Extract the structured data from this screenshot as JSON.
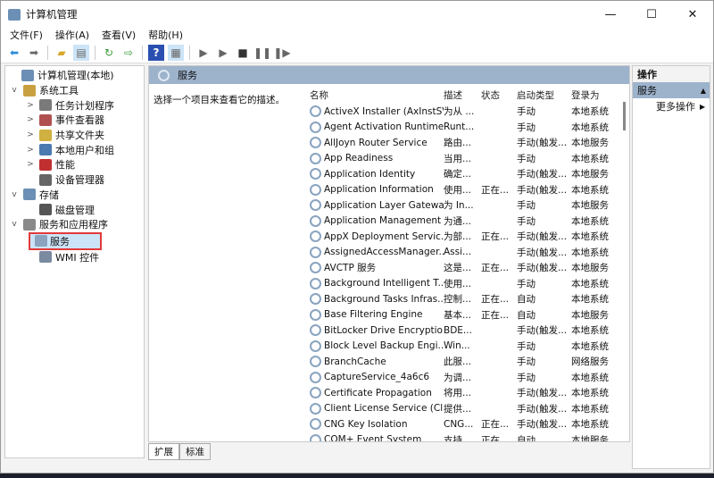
{
  "window": {
    "title": "计算机管理",
    "controls": [
      "—",
      "☐",
      "✕"
    ]
  },
  "menu": [
    "文件(F)",
    "操作(A)",
    "查看(V)",
    "帮助(H)"
  ],
  "toolbar": {
    "icons": [
      "back-icon",
      "forward-icon",
      "up-folder-icon",
      "show-hide-tree-icon",
      "refresh-icon",
      "export-icon",
      "help-icon",
      "properties-icon",
      "start-icon",
      "start-alt-icon",
      "stop-icon",
      "pause-icon",
      "resume-icon"
    ]
  },
  "tree": [
    {
      "label": "计算机管理(本地)",
      "level": 0,
      "expander": ""
    },
    {
      "label": "系统工具",
      "level": 1,
      "expander": "v"
    },
    {
      "label": "任务计划程序",
      "level": 2,
      "expander": ">"
    },
    {
      "label": "事件查看器",
      "level": 2,
      "expander": ">"
    },
    {
      "label": "共享文件夹",
      "level": 2,
      "expander": ">"
    },
    {
      "label": "本地用户和组",
      "level": 2,
      "expander": ">"
    },
    {
      "label": "性能",
      "level": 2,
      "expander": ">"
    },
    {
      "label": "设备管理器",
      "level": 2,
      "expander": ""
    },
    {
      "label": "存储",
      "level": 1,
      "expander": "v"
    },
    {
      "label": "磁盘管理",
      "level": 2,
      "expander": ""
    },
    {
      "label": "服务和应用程序",
      "level": 1,
      "expander": "v"
    },
    {
      "label": "服务",
      "level": 2,
      "expander": "",
      "selected": true
    },
    {
      "label": "WMI 控件",
      "level": 2,
      "expander": ""
    }
  ],
  "main": {
    "header": "服务",
    "description": "选择一个项目来查看它的描述。",
    "columns": [
      "名称",
      "描述",
      "状态",
      "启动类型",
      "登录为"
    ],
    "rows": [
      [
        "ActiveX Installer (AxInstSV)",
        "为从 ...",
        "",
        "手动",
        "本地系统"
      ],
      [
        "Agent Activation Runtime...",
        "Runt...",
        "",
        "手动",
        "本地系统"
      ],
      [
        "AllJoyn Router Service",
        "路由...",
        "",
        "手动(触发...",
        "本地服务"
      ],
      [
        "App Readiness",
        "当用...",
        "",
        "手动",
        "本地系统"
      ],
      [
        "Application Identity",
        "确定...",
        "",
        "手动(触发...",
        "本地服务"
      ],
      [
        "Application Information",
        "使用...",
        "正在...",
        "手动(触发...",
        "本地系统"
      ],
      [
        "Application Layer Gatewa...",
        "为 In...",
        "",
        "手动",
        "本地服务"
      ],
      [
        "Application Management",
        "为通...",
        "",
        "手动",
        "本地系统"
      ],
      [
        "AppX Deployment Servic...",
        "为部...",
        "正在...",
        "手动(触发...",
        "本地系统"
      ],
      [
        "AssignedAccessManager...",
        "Assi...",
        "",
        "手动(触发...",
        "本地系统"
      ],
      [
        "AVCTP 服务",
        "这是...",
        "正在...",
        "手动(触发...",
        "本地服务"
      ],
      [
        "Background Intelligent T...",
        "使用...",
        "",
        "手动",
        "本地系统"
      ],
      [
        "Background Tasks Infras...",
        "控制...",
        "正在...",
        "自动",
        "本地系统"
      ],
      [
        "Base Filtering Engine",
        "基本...",
        "正在...",
        "自动",
        "本地服务"
      ],
      [
        "BitLocker Drive Encryptio...",
        "BDE...",
        "",
        "手动(触发...",
        "本地系统"
      ],
      [
        "Block Level Backup Engi...",
        "Win...",
        "",
        "手动",
        "本地系统"
      ],
      [
        "BranchCache",
        "此服...",
        "",
        "手动",
        "网络服务"
      ],
      [
        "CaptureService_4a6c6",
        "为调...",
        "",
        "手动",
        "本地系统"
      ],
      [
        "Certificate Propagation",
        "将用...",
        "",
        "手动(触发...",
        "本地系统"
      ],
      [
        "Client License Service (Cli...",
        "提供...",
        "",
        "手动(触发...",
        "本地系统"
      ],
      [
        "CNG Key Isolation",
        "CNG...",
        "正在...",
        "手动(触发...",
        "本地系统"
      ],
      [
        "COM+ Event System",
        "支持...",
        "正在...",
        "自动",
        "本地服务"
      ]
    ]
  },
  "bottom_tabs": [
    "扩展",
    "标准"
  ],
  "actions": {
    "title": "操作",
    "section": "服务",
    "more": "更多操作"
  }
}
